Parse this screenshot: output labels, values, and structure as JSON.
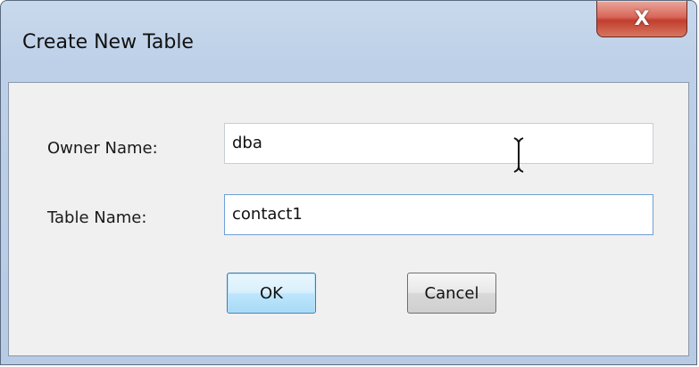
{
  "dialog": {
    "title": "Create New Table",
    "close_glyph": "X",
    "owner_label": "Owner Name:",
    "owner_value": "dba",
    "table_label": "Table Name:",
    "table_value": "contact1",
    "ok_label": "OK",
    "cancel_label": "Cancel"
  },
  "icons": {
    "close": "close-icon",
    "cursor": "text-cursor-icon"
  },
  "colors": {
    "frame": "#bdd0e8",
    "close_button": "#c23e2f",
    "focus_border": "#6f9fd8",
    "default_button": "#bee6fd"
  }
}
